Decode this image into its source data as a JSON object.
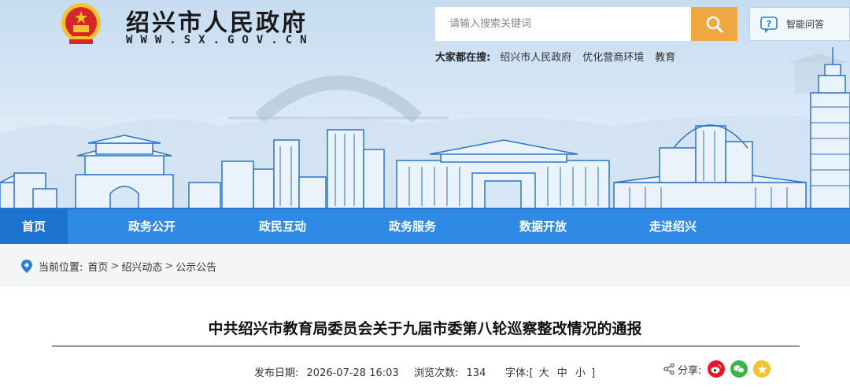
{
  "header": {
    "site_name": "绍兴市人民政府",
    "site_url": "WWW.SX.GOV.CN",
    "search": {
      "placeholder": "请输入搜索关键词"
    },
    "ai_button_label": "智能问答",
    "hot": {
      "label": "大家都在搜:",
      "links": [
        "绍兴市人民政府",
        "优化营商环境",
        "教育"
      ]
    }
  },
  "nav": {
    "items": [
      "首页",
      "政务公开",
      "政民互动",
      "政务服务",
      "数据开放",
      "走进绍兴"
    ],
    "active_index": 0
  },
  "breadcrumb": {
    "label": "当前位置:",
    "items": [
      "首页",
      "绍兴动态",
      "公示公告"
    ],
    "separator": ">"
  },
  "article": {
    "title": "中共绍兴市教育局委员会关于九届市委第八轮巡察整改情况的通报",
    "publish_label": "发布日期:",
    "publish_date": "2026-07-28 16:03",
    "views_label": "浏览次数:",
    "views": "134",
    "font_label": "字体:[",
    "font_sizes": [
      "大",
      "中",
      "小"
    ],
    "font_close": "]",
    "share_label": "分享:"
  },
  "colors": {
    "nav_bg": "#2f8ae6",
    "nav_active": "#1b72cf",
    "search_btn": "#f0a742",
    "weibo": "#e6162d",
    "wechat": "#39b54a",
    "qzone": "#f5c22b"
  },
  "icons": [
    "national-emblem-icon",
    "search-icon",
    "ai-chat-icon",
    "location-pin-icon",
    "share-icon",
    "weibo-icon",
    "wechat-icon",
    "qzone-icon"
  ]
}
